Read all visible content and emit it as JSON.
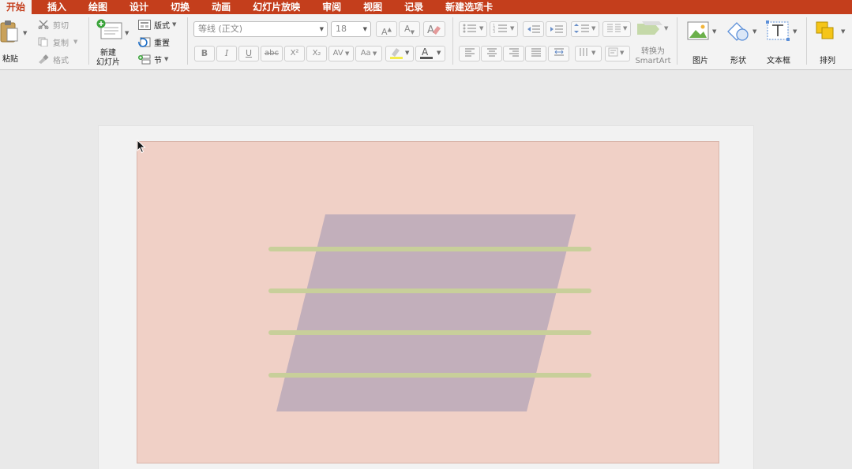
{
  "tabs": [
    "开始",
    "插入",
    "绘图",
    "设计",
    "切换",
    "动画",
    "幻灯片放映",
    "审阅",
    "视图",
    "记录",
    "新建选项卡"
  ],
  "clipboard": {
    "paste": "粘贴",
    "cut": "剪切",
    "copy": "复制",
    "format": "格式"
  },
  "slides": {
    "new_slide_line1": "新建",
    "new_slide_line2": "幻灯片",
    "layout": "版式",
    "reset": "重置",
    "section": "节"
  },
  "font": {
    "name": "等线 (正文)",
    "size": "18",
    "bold": "B",
    "italic": "I",
    "underline": "U",
    "strike": "abc",
    "superscript": "X²",
    "subscript": "X₂",
    "spacing": "AV",
    "case": "Aa"
  },
  "paragraph": {
    "smartart_line1": "转换为",
    "smartart_line2": "SmartArt"
  },
  "insert": {
    "picture": "图片",
    "shape": "形状",
    "textbox": "文本框",
    "arrange": "排列"
  },
  "colors": {
    "accent": "#c43e1c",
    "slide_bg": "#f0d0c6",
    "parallelogram": "#c2afbb",
    "stripe": "#c8cf9a"
  }
}
